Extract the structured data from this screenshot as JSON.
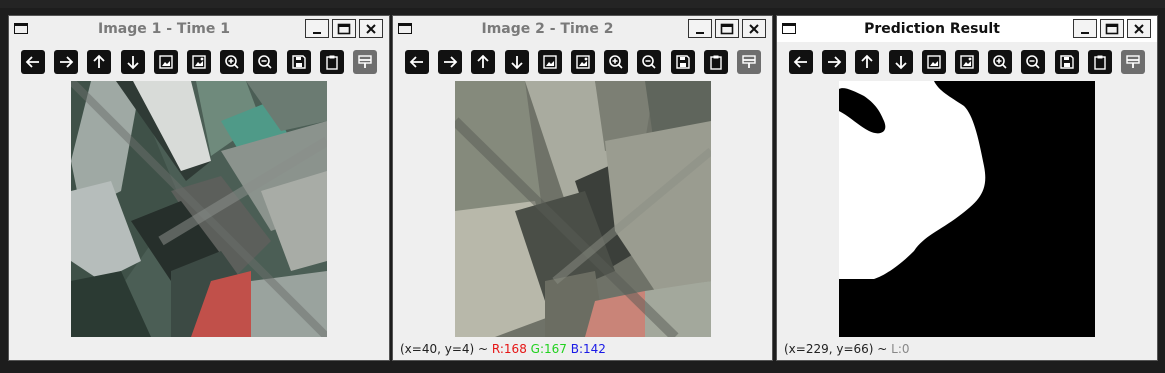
{
  "windows": [
    {
      "title": "Image 1 - Time 1",
      "state": "inactive",
      "status": null
    },
    {
      "title": "Image 2 - Time 2",
      "state": "inactive",
      "status": {
        "coords": "(x=40, y=4) ~ ",
        "r": "R:168",
        "g": "G:167",
        "b": "B:142"
      }
    },
    {
      "title": "Prediction Result",
      "state": "active",
      "status": {
        "coords": "(x=229, y=66) ~ ",
        "l": "L:0"
      }
    }
  ],
  "toolbar_icons": [
    "arrow-left-icon",
    "arrow-right-icon",
    "arrow-up-icon",
    "arrow-down-icon",
    "image-icon",
    "image-alt-icon",
    "zoom-in-icon",
    "zoom-out-icon",
    "save-icon",
    "clipboard-icon",
    "paint-icon"
  ],
  "colors": {
    "red": "#e61515",
    "green": "#22d11f",
    "blue": "#1a1ae6"
  }
}
